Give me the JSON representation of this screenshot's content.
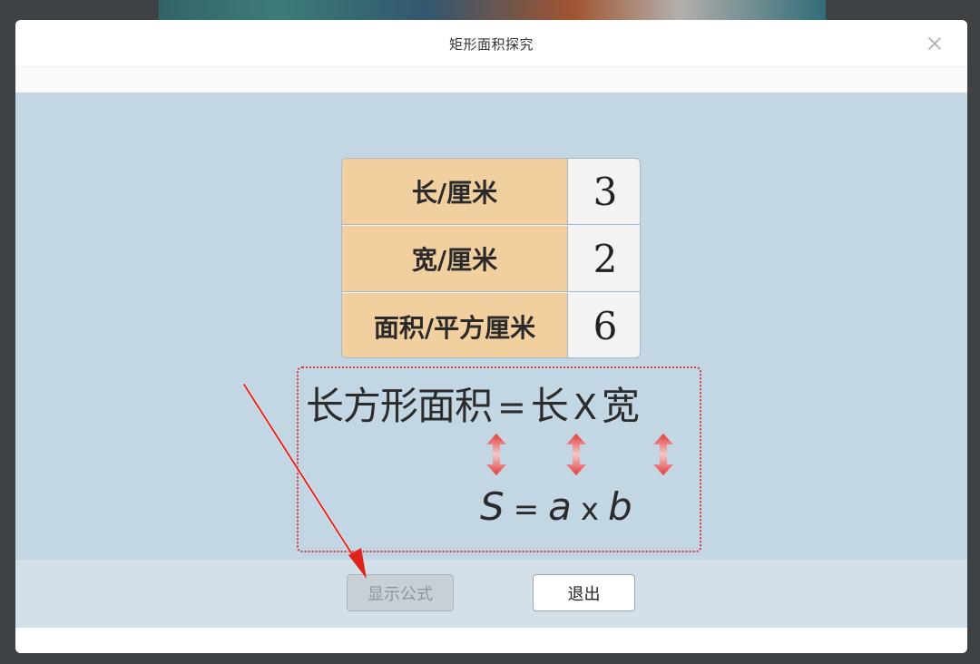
{
  "dialog": {
    "title": "矩形面积探究"
  },
  "table": {
    "rows": [
      {
        "label": "长/厘米",
        "value": "3"
      },
      {
        "label": "宽/厘米",
        "value": "2"
      },
      {
        "label": "面积/平方厘米",
        "value": "6"
      }
    ]
  },
  "formula": {
    "chinese": {
      "lhs": "长方形面积",
      "eq": "=",
      "length": "长",
      "times": "X",
      "width": "宽"
    },
    "symbolic": {
      "lhs": "S",
      "eq": "=",
      "a": "a",
      "times": "x",
      "b": "b"
    }
  },
  "buttons": {
    "show_formula": "显示公式",
    "exit": "退出"
  },
  "colors": {
    "content_bg": "#c2d6e4",
    "label_bg": "#f1cf9f",
    "dotted_border": "#d63a3a",
    "arrow": "#e0241c"
  }
}
